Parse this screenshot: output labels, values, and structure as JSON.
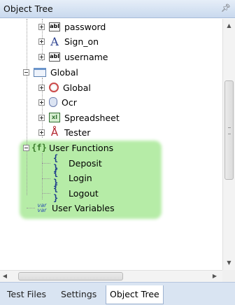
{
  "panel": {
    "title": "Object Tree",
    "pin_icon": "pin-icon"
  },
  "tree": {
    "items": [
      {
        "label": "password",
        "icon": "edit-field-icon",
        "icon_text": "abl"
      },
      {
        "label": "Sign_on",
        "icon": "static-text-icon",
        "icon_text": "A"
      },
      {
        "label": "username",
        "icon": "edit-field-icon",
        "icon_text": "abl"
      },
      {
        "label": "Global",
        "icon": "window-icon"
      },
      {
        "label": "Global",
        "icon": "global-object-icon"
      },
      {
        "label": "Ocr",
        "icon": "ocr-icon"
      },
      {
        "label": "Spreadsheet",
        "icon": "spreadsheet-icon",
        "icon_text": "xl"
      },
      {
        "label": "Tester",
        "icon": "tester-icon",
        "icon_text": "Å"
      },
      {
        "label": "User Functions",
        "icon": "user-functions-icon",
        "icon_text": "{f}"
      },
      {
        "label": "Deposit",
        "icon": "function-icon",
        "icon_text": "{ }"
      },
      {
        "label": "Login",
        "icon": "function-icon",
        "icon_text": "{ }"
      },
      {
        "label": "Logout",
        "icon": "function-icon",
        "icon_text": "{ }"
      },
      {
        "label": "User Variables",
        "icon": "user-variables-icon",
        "icon_text": "var var"
      }
    ],
    "highlight_color": "#9ee68a"
  },
  "tabs": [
    {
      "label": "Test Files",
      "active": false
    },
    {
      "label": "Settings",
      "active": false
    },
    {
      "label": "Object Tree",
      "active": true
    }
  ]
}
